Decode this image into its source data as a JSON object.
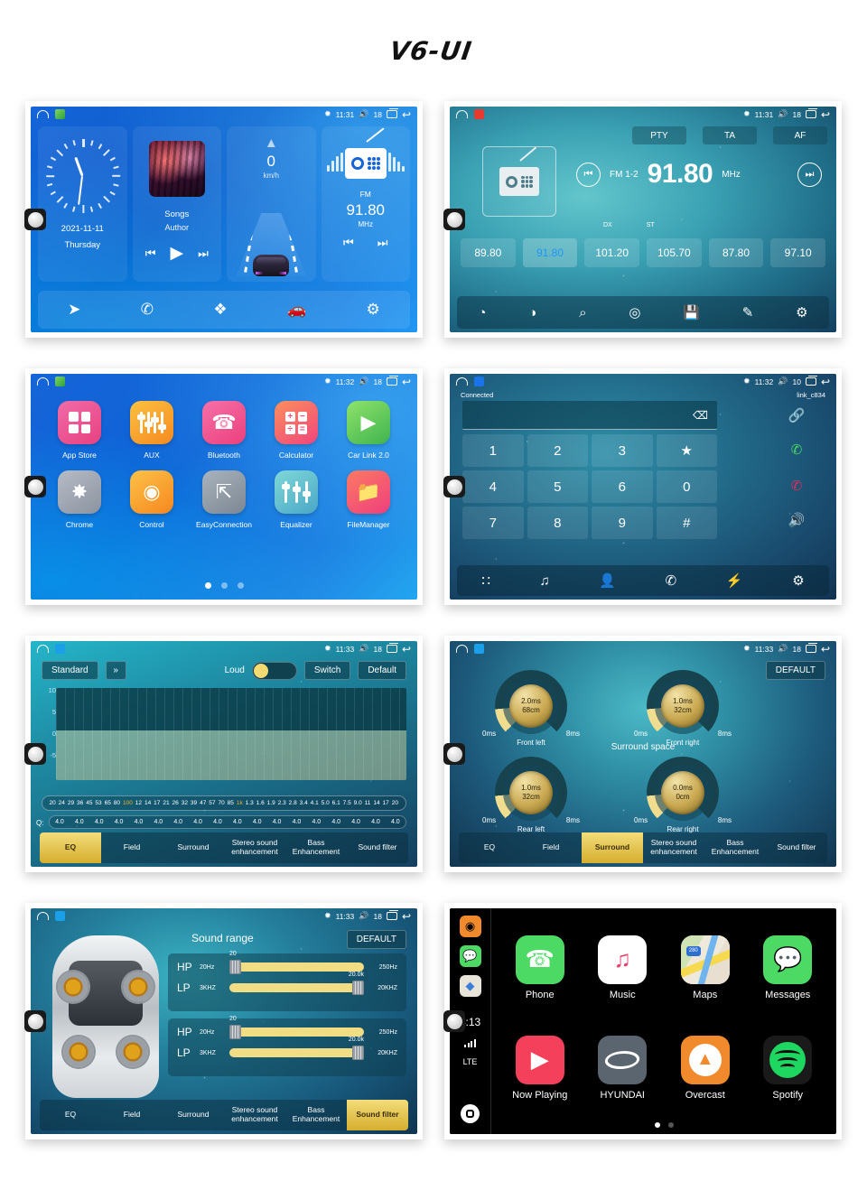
{
  "page": {
    "title": "V6-UI"
  },
  "status_bar": {
    "home_icon": "home-outline-icon",
    "bt_icon": "bluetooth-icon",
    "vol_icon": "volume-icon",
    "recents_icon": "recents-icon",
    "back_icon": "back-icon",
    "screens": [
      {
        "time": "11:31",
        "volume": "18"
      },
      {
        "time": "11:31",
        "volume": "18"
      },
      {
        "time": "11:32",
        "volume": "18"
      },
      {
        "time": "11:32",
        "volume": "10"
      },
      {
        "time": "11:33",
        "volume": "18"
      },
      {
        "time": "11:33",
        "volume": "18"
      },
      {
        "time": "11:33",
        "volume": "18"
      }
    ]
  },
  "home": {
    "clock": {
      "date": "2021-11-11",
      "weekday": "Thursday"
    },
    "music": {
      "title": "Songs",
      "artist": "Author",
      "prev": "⏮",
      "play": "▶",
      "next": "⏭"
    },
    "speed": {
      "value": "0",
      "unit": "km/h",
      "arrow": "▲"
    },
    "radio": {
      "band": "FM",
      "freq": "91.80",
      "unit": "MHz",
      "prev": "⏮",
      "next": "⏭"
    },
    "dock": [
      {
        "name": "navigation-icon",
        "glyph": "➤"
      },
      {
        "name": "phone-icon",
        "glyph": "✆"
      },
      {
        "name": "apps-icon",
        "glyph": "❖"
      },
      {
        "name": "car-link-icon",
        "glyph": "🚗"
      },
      {
        "name": "settings-icon",
        "glyph": "⚙"
      }
    ]
  },
  "radio": {
    "rds_buttons": [
      "PTY",
      "TA",
      "AF"
    ],
    "band": "FM 1-2",
    "frequency": "91.80",
    "unit": "MHz",
    "prev_glyph": "⏮",
    "next_glyph": "⏭",
    "dx_label": "DX",
    "st_label": "ST",
    "presets": [
      "89.80",
      "91.80",
      "101.20",
      "105.70",
      "87.80",
      "97.10"
    ],
    "active_preset_index": 1,
    "dock": [
      {
        "name": "loudness-icon",
        "glyph": "◔"
      },
      {
        "name": "stereo-mono-icon",
        "glyph": "◑"
      },
      {
        "name": "scan-icon",
        "glyph": "⌕"
      },
      {
        "name": "rds-icon",
        "glyph": "◎"
      },
      {
        "name": "save-icon",
        "glyph": "💾"
      },
      {
        "name": "edit-icon",
        "glyph": "✎"
      },
      {
        "name": "settings-icon",
        "glyph": "⚙"
      }
    ]
  },
  "apps": {
    "items": [
      {
        "label": "App Store",
        "icon": "grid-icon",
        "color1": "#f06ca8",
        "color2": "#e7417f"
      },
      {
        "label": "AUX",
        "icon": "faders-icon",
        "color1": "#fcc13f",
        "color2": "#f58a21"
      },
      {
        "label": "Bluetooth",
        "icon": "phone-icon",
        "color1": "#f571a8",
        "color2": "#ec3f7d"
      },
      {
        "label": "Calculator",
        "icon": "calculator-icon",
        "color1": "#fb8f5c",
        "color2": "#f0457c"
      },
      {
        "label": "Car Link 2.0",
        "icon": "play-icon",
        "color1": "#8fe36a",
        "color2": "#3fb34f"
      },
      {
        "label": "Chrome",
        "icon": "compass-icon",
        "color1": "#b6bcc6",
        "color2": "#8b93a0"
      },
      {
        "label": "Control",
        "icon": "steering-icon",
        "color1": "#fcc246",
        "color2": "#f6881f"
      },
      {
        "label": "EasyConnection",
        "icon": "mirror-icon",
        "color1": "#a9b3bd",
        "color2": "#7d8793"
      },
      {
        "label": "Equalizer",
        "icon": "sliders-icon",
        "color1": "#7fd8d8",
        "color2": "#4aa7c6"
      },
      {
        "label": "FileManager",
        "icon": "folder-icon",
        "color1": "#fb7a62",
        "color2": "#ef3f7e"
      }
    ],
    "page_dots": 3,
    "active_dot": 0
  },
  "bluetooth": {
    "status": "Connected",
    "device": "link_c834",
    "input_value": "",
    "backspace_glyph": "⌫",
    "keys": [
      "1",
      "2",
      "3",
      "★",
      "4",
      "5",
      "6",
      "0",
      "7",
      "8",
      "9",
      "#"
    ],
    "side": [
      {
        "name": "link-icon",
        "glyph": "🔗"
      },
      {
        "name": "call-answer-icon",
        "glyph": "✆"
      },
      {
        "name": "call-end-icon",
        "glyph": "✆"
      },
      {
        "name": "speaker-icon",
        "glyph": "🔊"
      }
    ],
    "dock": [
      {
        "name": "keypad-icon",
        "glyph": "∷"
      },
      {
        "name": "music-icon",
        "glyph": "♫"
      },
      {
        "name": "contacts-icon",
        "glyph": "👤"
      },
      {
        "name": "call-log-icon",
        "glyph": "✆"
      },
      {
        "name": "sync-icon",
        "glyph": "⚡"
      },
      {
        "name": "settings-icon",
        "glyph": "⚙"
      }
    ]
  },
  "audio_tabs": {
    "labels": [
      "EQ",
      "Field",
      "Surround",
      "Stereo sound enhancement",
      "Bass Enhancement",
      "Sound filter"
    ],
    "eq_active": 0,
    "surround_active": 2,
    "filter_active": 5
  },
  "equalizer": {
    "preset": "Standard",
    "dropdown_glyph": "»",
    "loud_label": "Loud",
    "loud_on": true,
    "switch_label": "Switch",
    "default_label": "Default",
    "y_ticks": [
      "10",
      "5",
      "0",
      "-5"
    ],
    "q_label": "Q:",
    "frequencies": [
      "20",
      "24",
      "29",
      "36",
      "45",
      "53",
      "65",
      "80",
      "100",
      "12",
      "14",
      "17",
      "21",
      "26",
      "32",
      "39",
      "47",
      "57",
      "70",
      "85",
      "1k",
      "1.3",
      "1.6",
      "1.9",
      "2.3",
      "2.8",
      "3.4",
      "4.1",
      "5.0",
      "6.1",
      "7.5",
      "9.0",
      "11",
      "14",
      "17",
      "20"
    ],
    "highlighted_frequencies": [
      "100",
      "1k"
    ],
    "q_values": [
      "4.0",
      "4.0",
      "4.0",
      "4.0",
      "4.0",
      "4.0",
      "4.0",
      "4.0",
      "4.0",
      "4.0",
      "4.0",
      "4.0",
      "4.0",
      "4.0",
      "4.0",
      "4.0",
      "4.0",
      "4.0"
    ]
  },
  "surround": {
    "title": "Surround space",
    "default_label": "DEFAULT",
    "min_label": "0ms",
    "max_label": "8ms",
    "knobs": [
      {
        "name": "Front left",
        "delay": "2.0ms",
        "distance": "68cm"
      },
      {
        "name": "Front right",
        "delay": "1.0ms",
        "distance": "32cm"
      },
      {
        "name": "Rear left",
        "delay": "1.0ms",
        "distance": "32cm"
      },
      {
        "name": "Rear right",
        "delay": "0.0ms",
        "distance": "0cm"
      }
    ]
  },
  "sound_filter": {
    "title": "Sound range",
    "default_label": "DEFAULT",
    "blocks": [
      {
        "rows": [
          {
            "tag": "HP",
            "min": "20Hz",
            "max": "250Hz",
            "value": "20",
            "pos": "low"
          },
          {
            "tag": "LP",
            "min": "3KHZ",
            "max": "20KHZ",
            "value": "20.0k",
            "pos": "high"
          }
        ]
      },
      {
        "rows": [
          {
            "tag": "HP",
            "min": "20Hz",
            "max": "250Hz",
            "value": "20",
            "pos": "low"
          },
          {
            "tag": "LP",
            "min": "3KHZ",
            "max": "20KHZ",
            "value": "20.0k",
            "pos": "high"
          }
        ]
      }
    ]
  },
  "carplay": {
    "time": "4:13",
    "network": "LTE",
    "rail": [
      {
        "name": "overcast-icon",
        "glyph": "📡",
        "bg": "#f08a2c"
      },
      {
        "name": "messages-icon",
        "glyph": "💬",
        "bg": "#4cd964"
      },
      {
        "name": "maps-icon",
        "glyph": "🗺",
        "bg": "#f2f2f2"
      }
    ],
    "apps": [
      {
        "label": "Phone",
        "icon": "phone-icon",
        "bg": "#4cd964"
      },
      {
        "label": "Music",
        "icon": "music-note-icon",
        "bg": "#ffffff"
      },
      {
        "label": "Maps",
        "icon": "maps-icon",
        "bg": "#e9e4d8"
      },
      {
        "label": "Messages",
        "icon": "messages-icon",
        "bg": "#4cd964"
      },
      {
        "label": "Now Playing",
        "icon": "play-icon",
        "bg": "#f4405a"
      },
      {
        "label": "HYUNDAI",
        "icon": "hyundai-logo-icon",
        "bg": "#5a6570"
      },
      {
        "label": "Overcast",
        "icon": "overcast-icon",
        "bg": "#f08a2c"
      },
      {
        "label": "Spotify",
        "icon": "spotify-icon",
        "bg": "#1a1a1a"
      }
    ],
    "page_dots": 2,
    "active_dot": 0,
    "maps_shield": "280"
  }
}
